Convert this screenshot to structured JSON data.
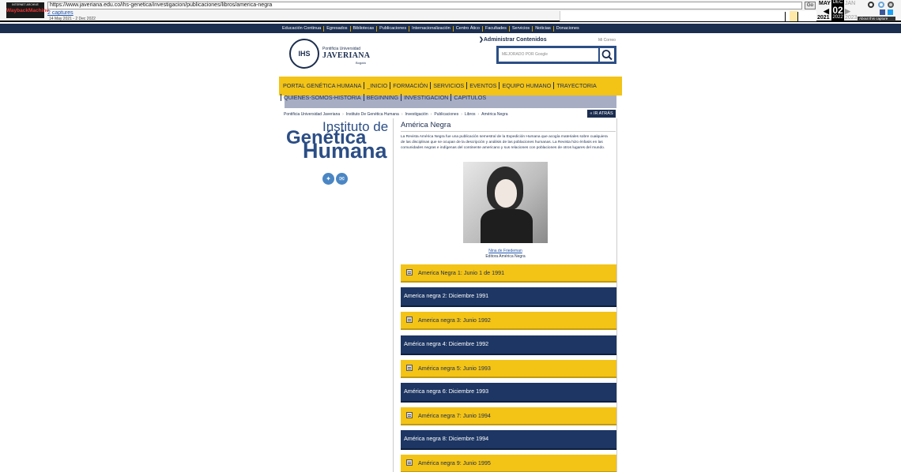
{
  "wayback": {
    "logo_top": "INTERNET ARCHIVE",
    "logo_main": "WaybackMachine",
    "url": "https://www.javeriana.edu.co/ihs-genetica/investigacion/publicaciones/libros/america-negra",
    "go_label": "Go",
    "captures": "2 captures",
    "range": "14 May 2021 - 2 Dec 2022",
    "month_prev": "MAY",
    "month_cur": "DEC",
    "month_next": "JAN",
    "day": "02",
    "year_prev": "2021",
    "year_cur": "2022",
    "year_next": "2023",
    "about": "About this capture"
  },
  "topnav": [
    "Educación Continua",
    "Egresados",
    "Bibliotecas",
    "Publicaciones",
    "Internacionalización",
    "Centro Ático",
    "Facultades",
    "Servicios",
    "Noticias",
    "Donaciones"
  ],
  "header": {
    "admin_label": "Administrar Contenidos",
    "mail_label": "Mi Correo",
    "logo_small": "Pontificia Universidad",
    "logo_main": "JAVERIANA",
    "logo_city": "Bogotá",
    "logo_seal": "IHS",
    "search_placeholder": "MEJORADO POR Google"
  },
  "mainnav": {
    "row1": [
      "PORTAL GENÉTICA HUMANA",
      "_INICIO",
      "FORMACIÓN",
      "SERVICIOS",
      "EVENTOS",
      "EQUIPO HUMANO",
      "TRAYECTORIA"
    ],
    "row2": [
      "QUIENES-SOMOS-HISTORIA",
      "BEGINNING",
      "INVESTIGACION",
      "CAPITULOS"
    ]
  },
  "breadcrumb": [
    "Pontificia Universidad Javeriana",
    "Instituto De Genética Humana",
    "Investigación",
    "Publicaciones",
    "Libros",
    "América Negra"
  ],
  "back_label": "« IR ATRÁS",
  "sidebar": {
    "line1": "Instituto de",
    "line2": "Genética",
    "line3": "Humana"
  },
  "content": {
    "title": "América Negra",
    "intro": "La Revista América Negra fue una publicación semestral de la Expedición Humana que acogía materiales sobre cualquiera de las disciplinas que se ocupan de la descripción y análisis de las poblaciones humanas. La Revista hizo énfasis en las comunidades negras e indígenas del continente americano y sus relaciones con poblaciones de otros lugares del mundo.",
    "caption_link": "Nina de Friedeman",
    "caption_text": "Editora América Negra",
    "items": [
      {
        "label": "America Negra 1: Junio 1 de 1991",
        "style": "y"
      },
      {
        "label": "America negra 2: Diciembre 1991",
        "style": "b"
      },
      {
        "label": "America negra 3: Junio 1992",
        "style": "y"
      },
      {
        "label": "América negra 4: Diciembre 1992",
        "style": "b"
      },
      {
        "label": "América negra 5: Junio 1993",
        "style": "y"
      },
      {
        "label": "América negra 6: Diciembre 1993",
        "style": "b"
      },
      {
        "label": "América negra 7: Junio 1994",
        "style": "y"
      },
      {
        "label": "América negra 8: Diciembre 1994",
        "style": "b"
      },
      {
        "label": "América negra 9: Junio 1995",
        "style": "y"
      }
    ]
  },
  "colors": {
    "navy": "#1c2e4f",
    "yellow": "#f3c316",
    "blue_item": "#1d3663"
  }
}
